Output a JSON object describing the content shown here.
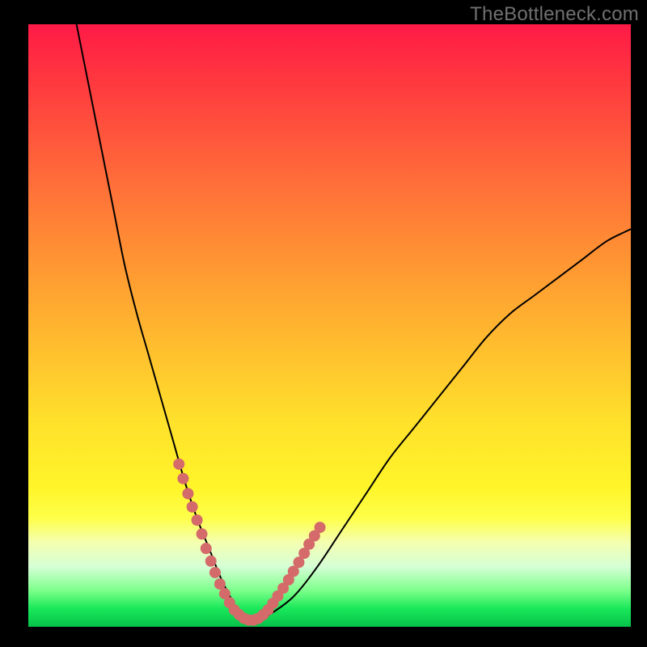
{
  "watermark": "TheBottleneck.com",
  "colors": {
    "frame": "#000000",
    "curve_stroke": "#000000",
    "dot_fill": "#d46a6a",
    "gradient_stops": [
      "#ff1a46",
      "#ff3a3f",
      "#ff6a3a",
      "#ff9133",
      "#ffc22e",
      "#ffe12b",
      "#fff52a",
      "#feff4a",
      "#f4ffb0",
      "#d6ffd6",
      "#7cff8a",
      "#19e859",
      "#06c14a"
    ]
  },
  "chart_data": {
    "type": "line",
    "title": "",
    "xlabel": "",
    "ylabel": "",
    "xlim": [
      0,
      100
    ],
    "ylim": [
      0,
      100
    ],
    "grid": false,
    "legend": false,
    "series": [
      {
        "name": "bottleneck-curve",
        "x": [
          8,
          10,
          12,
          14,
          16,
          18,
          20,
          22,
          24,
          26,
          28,
          30,
          32,
          34,
          35,
          36,
          38,
          40,
          44,
          48,
          52,
          56,
          60,
          64,
          68,
          72,
          76,
          80,
          84,
          88,
          92,
          96,
          100
        ],
        "values": [
          100,
          90,
          80,
          70,
          60,
          52,
          45,
          38,
          31,
          24,
          18,
          13,
          8,
          4,
          2,
          1,
          1,
          2,
          5,
          10,
          16,
          22,
          28,
          33,
          38,
          43,
          48,
          52,
          55,
          58,
          61,
          64,
          66
        ]
      }
    ],
    "dots": {
      "name": "highlight-dots",
      "x": [
        25.0,
        25.7,
        26.5,
        27.2,
        28.0,
        28.8,
        29.5,
        30.3,
        31.0,
        31.8,
        32.6,
        33.4,
        34.2,
        35.0,
        35.8,
        36.6,
        37.4,
        38.2,
        39.0,
        39.8,
        40.6,
        41.4,
        42.3,
        43.2,
        44.0,
        44.9,
        45.8,
        46.6,
        47.5,
        48.4
      ],
      "values": [
        27.0,
        24.6,
        22.1,
        19.9,
        17.7,
        15.4,
        13.0,
        10.9,
        9.0,
        7.1,
        5.5,
        4.0,
        2.8,
        2.0,
        1.4,
        1.1,
        1.1,
        1.4,
        2.0,
        2.8,
        3.9,
        5.1,
        6.4,
        7.8,
        9.2,
        10.7,
        12.2,
        13.7,
        15.1,
        16.5
      ]
    }
  }
}
